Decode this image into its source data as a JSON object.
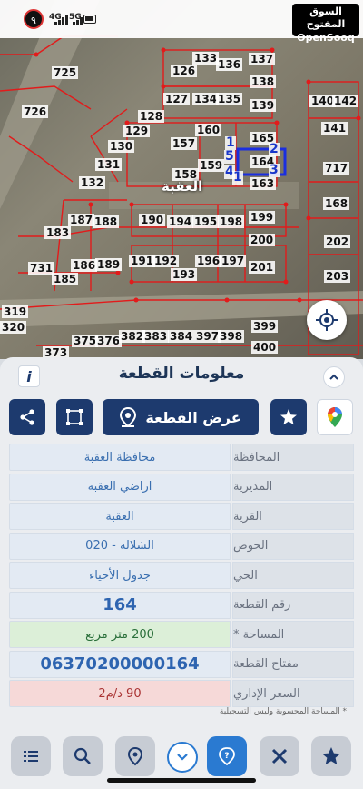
{
  "status_bar": {
    "clock_badge": "٩",
    "net1": "4G",
    "net2": "5G"
  },
  "brand": {
    "arabic": "السوق المفتوح",
    "english": "OpenSooq"
  },
  "map": {
    "area_label": "العقبة",
    "parcels": [
      "725",
      "726",
      "126",
      "133",
      "136",
      "137",
      "138",
      "127",
      "134",
      "135",
      "139",
      "140",
      "142",
      "128",
      "141",
      "129",
      "160",
      "157",
      "165",
      "130",
      "131",
      "159",
      "717",
      "158",
      "164",
      "132",
      "163",
      "168",
      "187",
      "188",
      "190",
      "194",
      "195",
      "198",
      "199",
      "183",
      "202",
      "200",
      "191",
      "192",
      "196",
      "197",
      "186",
      "189",
      "731",
      "201",
      "185",
      "193",
      "203",
      "319",
      "320",
      "399",
      "375",
      "376",
      "382",
      "383",
      "384",
      "397",
      "398",
      "400",
      "373"
    ],
    "highlight_numbers": [
      "2",
      "5",
      "3",
      "4",
      "1",
      "1"
    ]
  },
  "sheet": {
    "title": "معلومات القطعة",
    "info_label": "i",
    "show_parcel_label": "عرض القطعة",
    "rows": [
      {
        "key": "المحافظة",
        "value": "محافظة العقبة"
      },
      {
        "key": "المديرية",
        "value": "اراضي العقبه"
      },
      {
        "key": "القرية",
        "value": "العقبة"
      },
      {
        "key": "الحوض",
        "value": "الشلاله - 020"
      },
      {
        "key": "الحي",
        "value": "جدول الأحياء"
      },
      {
        "key": "رقم القطعة",
        "value": "164"
      },
      {
        "key": "المساحة *",
        "value": "200 متر مربع"
      },
      {
        "key": "مفتاح القطعة",
        "value": "06370200000164"
      },
      {
        "key": "السعر الإداري",
        "value": "90 د/م2"
      }
    ],
    "footnote": "* المساحة المحسوبة وليس التسجيلية"
  },
  "colors": {
    "primary": "#1d3a6e",
    "accent": "#2a7ad1",
    "area_bg": "#dcefd8",
    "price_bg": "#f6d9d8"
  },
  "toolbar": {
    "icons": [
      "list-icon",
      "search-icon",
      "location-pin-icon",
      "chevron-down-icon",
      "help-icon",
      "ruler-cross-icon",
      "star-icon"
    ]
  }
}
